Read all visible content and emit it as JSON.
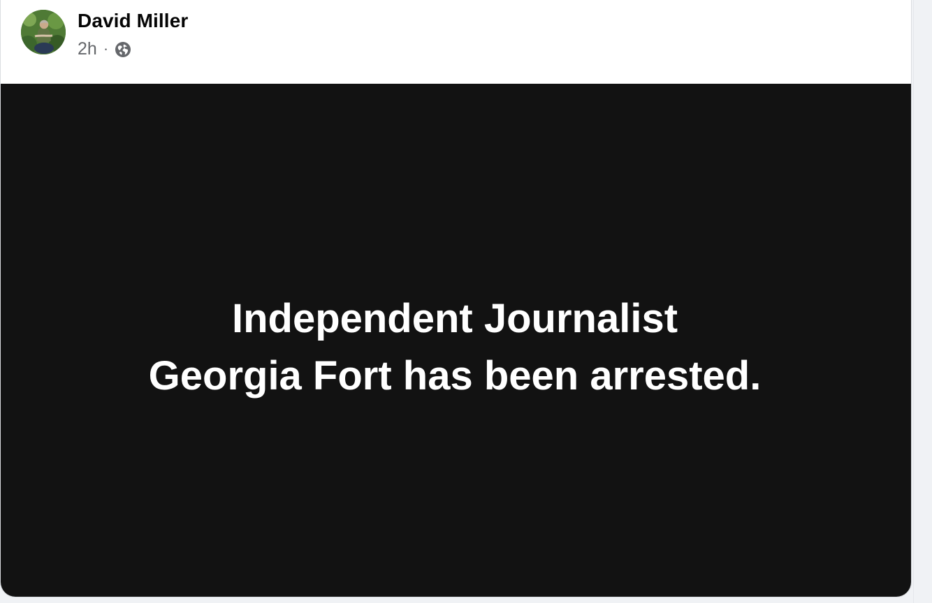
{
  "post": {
    "author_name": "David Miller",
    "timestamp": "2h",
    "separator": "·",
    "audience_icon": "globe-icon",
    "avatar_icon": "profile-photo"
  },
  "media": {
    "line1": "Independent Journalist",
    "line2": "Georgia Fort has been arrested.",
    "background_color": "#121212",
    "text_color": "#ffffff"
  },
  "colors": {
    "name_text": "#050505",
    "meta_text": "#65676b",
    "page_background": "#f0f2f5"
  }
}
